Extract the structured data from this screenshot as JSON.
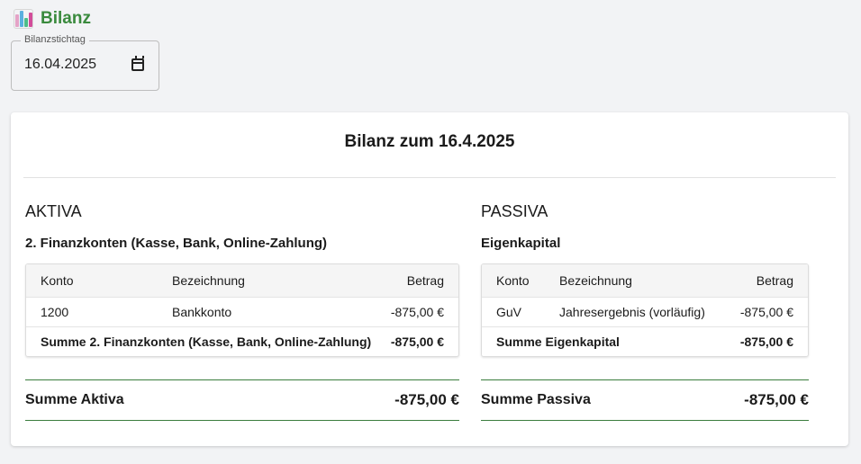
{
  "header": {
    "title": "Bilanz",
    "icon": "bar-chart-icon"
  },
  "date_field": {
    "label": "Bilanzstichtag",
    "value": "16.04.2025"
  },
  "report": {
    "title": "Bilanz zum 16.4.2025"
  },
  "aktiva": {
    "heading": "AKTIVA",
    "group": "2. Finanzkonten (Kasse, Bank, Online-Zahlung)",
    "columns": {
      "konto": "Konto",
      "bezeichnung": "Bezeichnung",
      "betrag": "Betrag"
    },
    "rows": [
      {
        "konto": "1200",
        "bezeichnung": "Bankkonto",
        "betrag": "-875,00 €"
      }
    ],
    "sum_label": "Summe 2. Finanzkonten (Kasse, Bank, Online-Zahlung)",
    "sum_value": "-875,00 €",
    "total_label": "Summe Aktiva",
    "total_value": "-875,00 €"
  },
  "passiva": {
    "heading": "PASSIVA",
    "group": "Eigenkapital",
    "columns": {
      "konto": "Konto",
      "bezeichnung": "Bezeichnung",
      "betrag": "Betrag"
    },
    "rows": [
      {
        "konto": "GuV",
        "bezeichnung": "Jahresergebnis (vorläufig)",
        "betrag": "-875,00 €"
      }
    ],
    "sum_label": "Summe Eigenkapital",
    "sum_value": "-875,00 €",
    "total_label": "Summe Passiva",
    "total_value": "-875,00 €"
  },
  "colors": {
    "accent": "#3a8a3d",
    "total_border": "#3a7d3e"
  }
}
